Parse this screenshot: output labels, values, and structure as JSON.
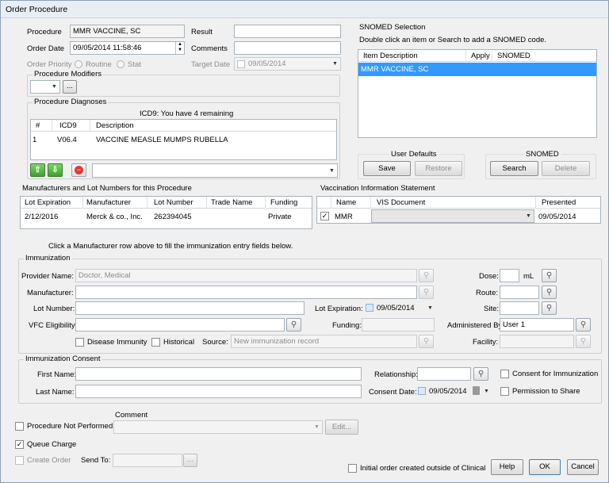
{
  "window": {
    "title": "Order Procedure"
  },
  "procedure": {
    "procedure_label": "Procedure",
    "procedure_value": "MMR VACCINE, SC",
    "order_date_label": "Order Date",
    "order_date_value": "09/05/2014 11:58:46",
    "order_priority_label": "Order Priority",
    "routine_label": "Routine",
    "stat_label": "Stat",
    "result_label": "Result",
    "comments_label": "Comments",
    "target_date_label": "Target Date",
    "target_date_value": "09/05/2014"
  },
  "modifiers": {
    "title": "Procedure Modifiers",
    "button": "..."
  },
  "diagnoses": {
    "title": "Procedure Diagnoses",
    "notice": "ICD9: You have 4 remaining",
    "columns": [
      "#",
      "ICD9",
      "Description"
    ],
    "rows": [
      {
        "num": "1",
        "icd9": "V06.4",
        "description": "VACCINE MEASLE MUMPS RUBELLA"
      }
    ]
  },
  "snomed": {
    "title": "SNOMED Selection",
    "instruction": "Double click an item or Search to add a SNOMED code.",
    "columns": [
      "Item Description",
      "Apply",
      "SNOMED"
    ],
    "rows": [
      {
        "item": "MMR VACCINE, SC"
      }
    ],
    "user_defaults_title": "User Defaults",
    "save": "Save",
    "restore": "Restore",
    "snomed_title": "SNOMED",
    "search": "Search",
    "delete": "Delete"
  },
  "manufacturers": {
    "title": "Manufacturers and Lot Numbers for this Procedure",
    "columns": [
      "Lot Expiration",
      "Manufacturer",
      "Lot Number",
      "Trade Name",
      "Funding"
    ],
    "rows": [
      {
        "expiration": "2/12/2016",
        "manufacturer": "Merck & co., Inc.",
        "lot": "262394045",
        "trade": "",
        "funding": "Private"
      }
    ],
    "hint": "Click  a Manufacturer row above to fill the immunization entry fields below."
  },
  "vis": {
    "title": "Vaccination Information Statement",
    "columns": [
      "Name",
      "VIS Document",
      "Presented"
    ],
    "rows": [
      {
        "name": "MMR",
        "document": "",
        "presented": "09/05/2014"
      }
    ]
  },
  "immunization": {
    "title": "Immunization",
    "provider_label": "Provider Name:",
    "provider_value": "Doctor, Medical",
    "manufacturer_label": "Manufacturer:",
    "lot_label": "Lot Number:",
    "lot_expiration_label": "Lot Expiration:",
    "lot_expiration_value": "09/05/2014",
    "vfc_label": "VFC Eligibility:",
    "funding_label": "Funding:",
    "disease_immunity_label": "Disease Immunity",
    "historical_label": "Historical",
    "source_label": "Source:",
    "source_value": "New immunization record",
    "dose_label": "Dose:",
    "dose_unit": "mL",
    "route_label": "Route:",
    "site_label": "Site:",
    "administered_label": "Administered By:",
    "administered_value": "User 1",
    "facility_label": "Facility:"
  },
  "consent": {
    "title": "Immunization Consent",
    "first_name_label": "First Name:",
    "last_name_label": "Last Name:",
    "relationship_label": "Relationship:",
    "consent_date_label": "Consent Date:",
    "consent_date_value": "09/05/2014",
    "consent_immunization_label": "Consent for Immunization",
    "permission_label": "Permission to Share"
  },
  "footer": {
    "comment_label": "Comment",
    "not_performed_label": "Procedure Not Performed",
    "edit_button": "Edit...",
    "queue_charge_label": "Queue Charge",
    "create_order_label": "Create Order",
    "send_to_label": "Send To:",
    "send_to_button": "...",
    "outside_label": "Initial order created outside of Clinical",
    "help": "Help",
    "ok": "OK",
    "cancel": "Cancel"
  }
}
